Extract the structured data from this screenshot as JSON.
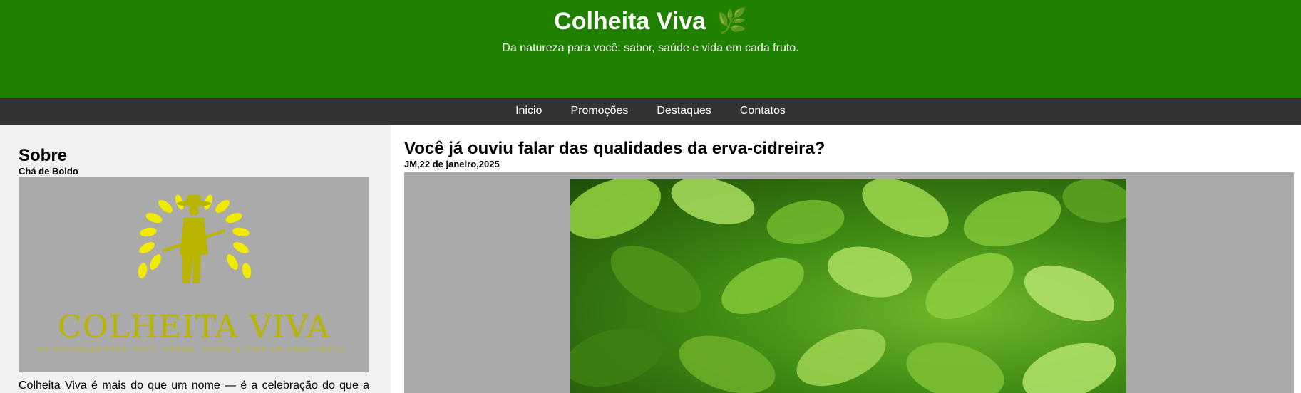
{
  "header": {
    "title": "Colheita Viva",
    "title_icon": "🌿",
    "tagline": "Da natureza para você: sabor, saúde e vida em cada fruto."
  },
  "nav": {
    "items": [
      {
        "label": "Inicio"
      },
      {
        "label": "Promoções"
      },
      {
        "label": "Destaques"
      },
      {
        "label": "Contatos"
      }
    ]
  },
  "sidebar": {
    "title": "Sobre",
    "subtitle": "Chá de Boldo",
    "logo": {
      "wordmark": "COLHEITA VIVA",
      "slogan": "Da natureza para você: sabor, saúde e vida em cada fruto."
    },
    "text": "Colheita Viva é mais do que um nome — é a celebração do que a"
  },
  "post": {
    "title": "Você já ouviu falar das qualidades da erva-cidreira?",
    "meta": "JM,22 de janeiro,2025"
  },
  "colors": {
    "header_bg": "#208000",
    "nav_bg": "#333333",
    "sidebar_bg": "#f1f1f1",
    "logo_bg": "#aaaaaa",
    "logo_color": "#b9b400"
  }
}
